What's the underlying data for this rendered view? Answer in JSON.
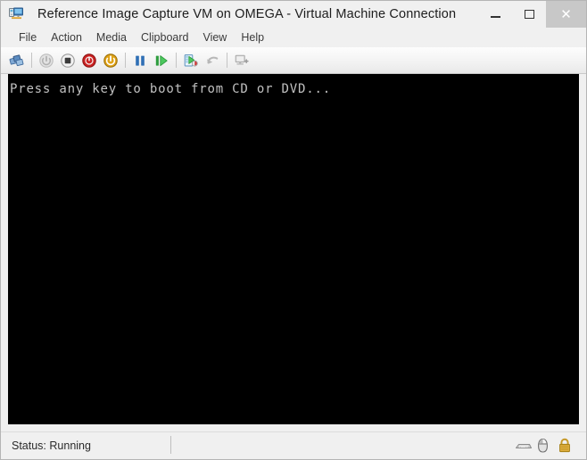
{
  "window": {
    "title": "Reference Image Capture VM on OMEGA - Virtual Machine Connection",
    "icon": "virtual-machine-icon",
    "controls": {
      "minimize": "–",
      "maximize": "□",
      "close": "✕"
    },
    "colors": {
      "frame_bg": "#f0f0f0",
      "frame_border": "#b5b5b5",
      "console_bg": "#000000",
      "console_fg": "#c0c0c0",
      "close_hover_bg": "#c8c8c8"
    }
  },
  "menubar": {
    "items": [
      {
        "label": "File",
        "name": "menu-file"
      },
      {
        "label": "Action",
        "name": "menu-action"
      },
      {
        "label": "Media",
        "name": "menu-media"
      },
      {
        "label": "Clipboard",
        "name": "menu-clipboard"
      },
      {
        "label": "View",
        "name": "menu-view"
      },
      {
        "label": "Help",
        "name": "menu-help"
      }
    ]
  },
  "toolbar": {
    "buttons": [
      {
        "name": "ctrl-alt-delete-icon",
        "tooltip": "Ctrl+Alt+Delete",
        "enabled": true
      },
      {
        "name": "start-icon",
        "tooltip": "Start",
        "enabled": false
      },
      {
        "name": "turn-off-icon",
        "tooltip": "Turn Off",
        "enabled": true
      },
      {
        "name": "shut-down-icon",
        "tooltip": "Shut Down",
        "enabled": true
      },
      {
        "name": "save-icon",
        "tooltip": "Save",
        "enabled": true
      },
      {
        "name": "pause-icon",
        "tooltip": "Pause",
        "enabled": true
      },
      {
        "name": "reset-icon",
        "tooltip": "Reset",
        "enabled": true
      },
      {
        "name": "checkpoint-icon",
        "tooltip": "Checkpoint",
        "enabled": true
      },
      {
        "name": "revert-icon",
        "tooltip": "Revert",
        "enabled": false
      },
      {
        "name": "enhanced-session-icon",
        "tooltip": "Enhanced Session",
        "enabled": false
      }
    ]
  },
  "console": {
    "lines": [
      "Press any key to boot from CD or DVD..."
    ]
  },
  "statusbar": {
    "status": "Status: Running",
    "icons": [
      {
        "name": "keyboard-icon"
      },
      {
        "name": "mouse-icon"
      },
      {
        "name": "lock-icon"
      }
    ]
  }
}
